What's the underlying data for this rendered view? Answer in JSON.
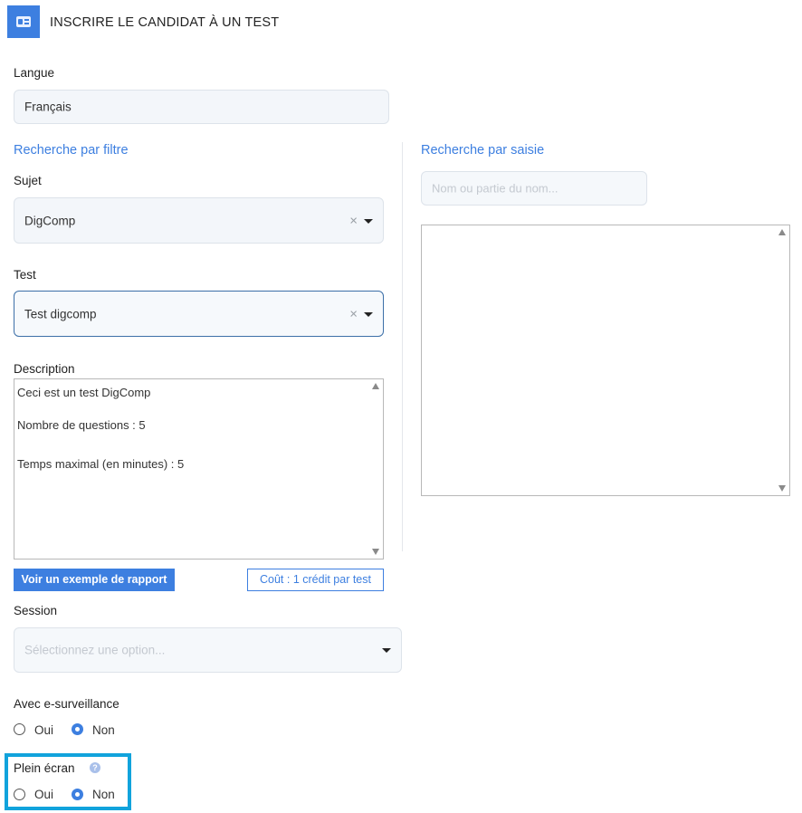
{
  "header": {
    "title": "INSCRIRE LE CANDIDAT À UN TEST",
    "icon": "id-card-icon"
  },
  "langue": {
    "label": "Langue",
    "value": "Français"
  },
  "filter_search": {
    "title": "Recherche par filtre",
    "sujet": {
      "label": "Sujet",
      "value": "DigComp",
      "clear": "×"
    },
    "test": {
      "label": "Test",
      "value": "Test digcomp",
      "clear": "×"
    },
    "description": {
      "label": "Description",
      "lines": [
        "Ceci est un test DigComp",
        "Nombre de questions : 5",
        "Temps maximal (en minutes) : 5"
      ]
    },
    "example_button": "Voir un exemple de rapport",
    "cost_button": "Coût : 1 crédit par test"
  },
  "session": {
    "label": "Session",
    "placeholder": "Sélectionnez une option..."
  },
  "e_surveillance": {
    "label": "Avec e-surveillance",
    "options": [
      "Oui",
      "Non"
    ],
    "selected": "Non"
  },
  "plein_ecran": {
    "label": "Plein écran",
    "help": "?",
    "options": [
      "Oui",
      "Non"
    ],
    "selected": "Non"
  },
  "text_search": {
    "title": "Recherche par saisie",
    "placeholder": "Nom ou partie du nom..."
  },
  "colors": {
    "accent": "#3d7fe0",
    "highlight": "#11a3dc"
  }
}
